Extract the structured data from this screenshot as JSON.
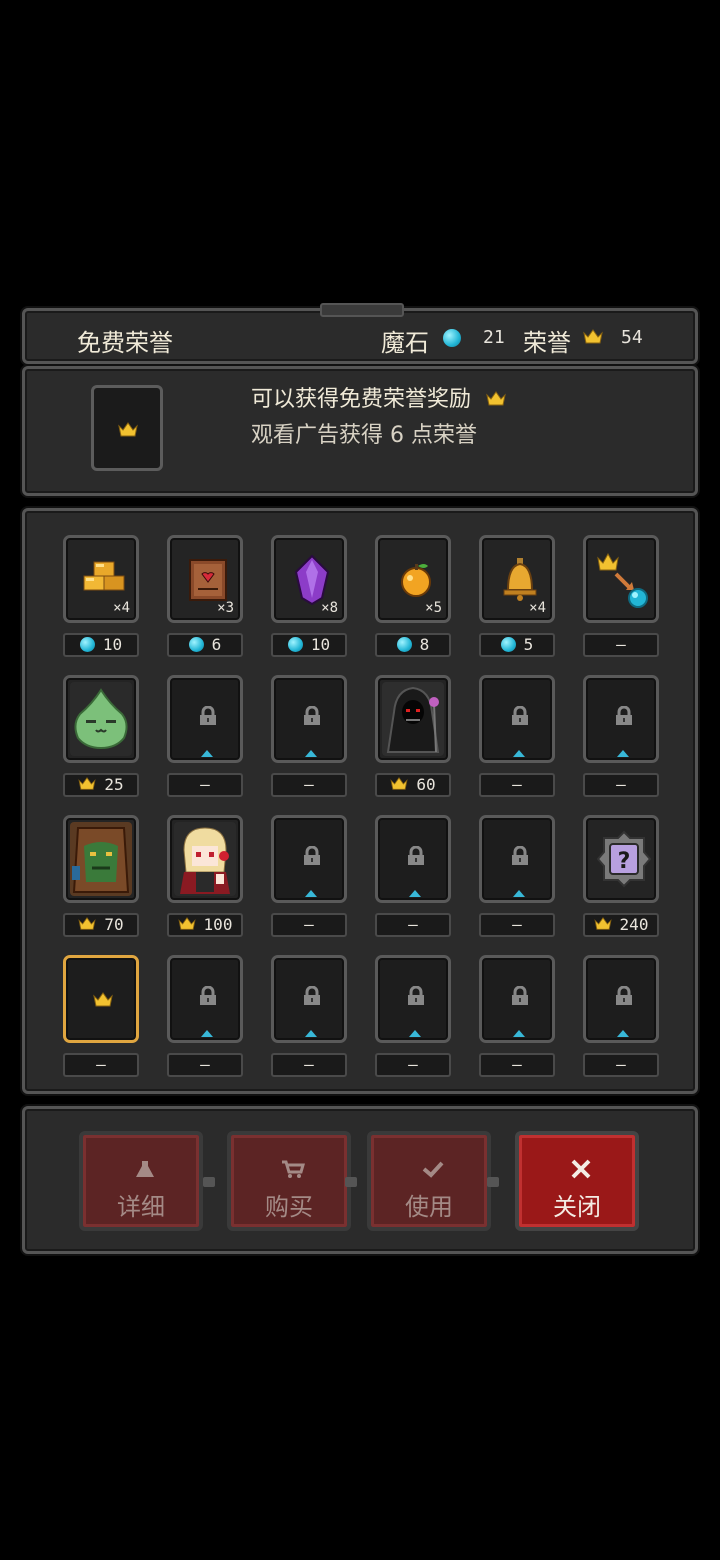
{
  "header": {
    "title": "免费荣誉",
    "magic_stone_label": "魔石",
    "magic_stone_value": "21",
    "honor_label": "荣誉",
    "honor_value": "54"
  },
  "info": {
    "line1": "可以获得免费荣誉奖励",
    "line2": "观看广告获得 6 点荣誉"
  },
  "colors": {
    "gem": "#22b6d6",
    "crown": "#f2c230",
    "selected_border": "#e0a640",
    "button_red": "#9a1818"
  },
  "grid": {
    "rows": [
      [
        {
          "icon": "gold-bars-icon",
          "count": "×4",
          "price": "10",
          "currency": "gem"
        },
        {
          "icon": "heart-scroll-icon",
          "count": "×3",
          "price": "6",
          "currency": "gem"
        },
        {
          "icon": "purple-crystal-icon",
          "count": "×8",
          "price": "10",
          "currency": "gem"
        },
        {
          "icon": "golden-apple-icon",
          "count": "×5",
          "price": "8",
          "currency": "gem"
        },
        {
          "icon": "golden-bell-icon",
          "count": "×4",
          "price": "5",
          "currency": "gem"
        },
        {
          "icon": "crown-to-gem-exchange-icon",
          "count": "",
          "price": "—",
          "currency": "none"
        }
      ],
      [
        {
          "icon": "green-slime-portrait",
          "price": "25",
          "currency": "crown"
        },
        {
          "icon": "lock-icon",
          "price": "—",
          "currency": "none"
        },
        {
          "icon": "lock-icon",
          "price": "—",
          "currency": "none"
        },
        {
          "icon": "dark-reaper-portrait",
          "price": "60",
          "currency": "crown"
        },
        {
          "icon": "lock-icon",
          "price": "—",
          "currency": "none"
        },
        {
          "icon": "lock-icon",
          "price": "—",
          "currency": "none"
        }
      ],
      [
        {
          "icon": "tree-golem-portrait",
          "price": "70",
          "currency": "crown"
        },
        {
          "icon": "blonde-vampire-girl-portrait",
          "price": "100",
          "currency": "crown"
        },
        {
          "icon": "lock-icon",
          "price": "—",
          "currency": "none"
        },
        {
          "icon": "lock-icon",
          "price": "—",
          "currency": "none"
        },
        {
          "icon": "lock-icon",
          "price": "—",
          "currency": "none"
        },
        {
          "icon": "mystery-question-icon",
          "price": "240",
          "currency": "crown"
        }
      ],
      [
        {
          "icon": "crown-icon",
          "price": "—",
          "currency": "none",
          "selected": true
        },
        {
          "icon": "lock-icon",
          "price": "—",
          "currency": "none"
        },
        {
          "icon": "lock-icon",
          "price": "—",
          "currency": "none"
        },
        {
          "icon": "lock-icon",
          "price": "—",
          "currency": "none"
        },
        {
          "icon": "lock-icon",
          "price": "—",
          "currency": "none"
        },
        {
          "icon": "lock-icon",
          "price": "—",
          "currency": "none"
        }
      ]
    ]
  },
  "buttons": {
    "detail": "详细",
    "buy": "购买",
    "use": "使用",
    "close": "关闭"
  }
}
